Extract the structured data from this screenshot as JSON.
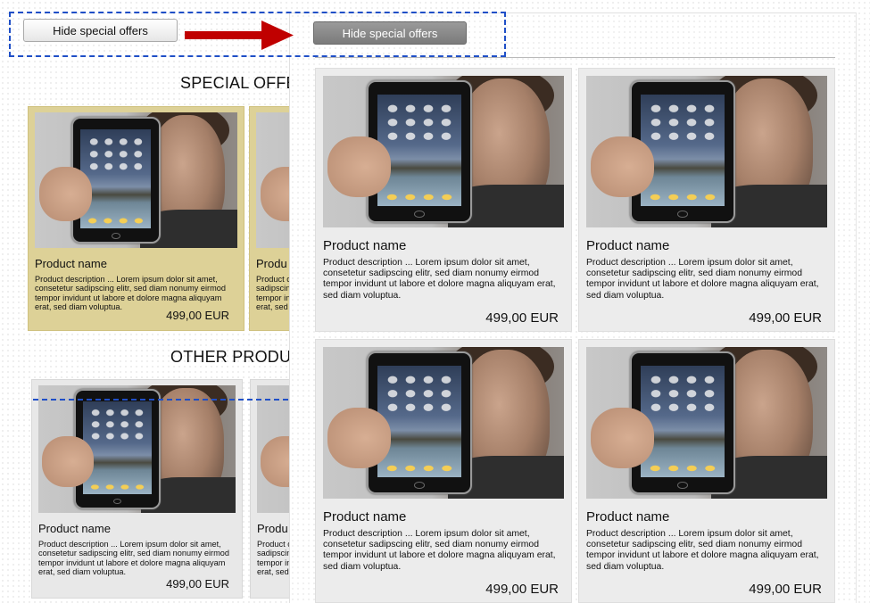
{
  "annotation": {
    "before_button_label": "Hide special offers",
    "after_button_label": "Hide special offers",
    "arrow_color": "#c00000",
    "highlight_color": "#1f4fc7"
  },
  "before_view": {
    "special_heading": "SPECIAL OFFE",
    "other_heading": "OTHER PRODU",
    "special_products": [
      {
        "name": "Product name",
        "description": "Product description  ... Lorem ipsum dolor sit amet, consetetur sadipscing elitr, sed diam nonumy eirmod tempor invidunt ut labore et dolore magna aliquyam erat, sed diam voluptua.",
        "price": "499,00 EUR"
      },
      {
        "name": "Produ",
        "description": "Product c sadipscin tempor in erat, sed",
        "price": ""
      }
    ],
    "other_products": [
      {
        "name": "Product name",
        "description": "Product description  ... Lorem ipsum dolor sit amet, consetetur sadipscing elitr, sed diam nonumy eirmod tempor invidunt ut labore et dolore magna aliquyam erat, sed diam voluptua.",
        "price": "499,00 EUR"
      },
      {
        "name": "Produ",
        "description": "Product c sadipscin tempor in erat, sed",
        "price": ""
      }
    ]
  },
  "after_view": {
    "products": [
      {
        "name": "Product name",
        "description": "Product description  ... Lorem ipsum dolor sit amet, consetetur sadipscing elitr, sed diam nonumy eirmod tempor invidunt ut labore et dolore magna aliquyam erat, sed diam voluptua.",
        "price": "499,00 EUR"
      },
      {
        "name": "Product name",
        "description": "Product description  ... Lorem ipsum dolor sit amet, consetetur sadipscing elitr, sed diam nonumy eirmod tempor invidunt ut labore et dolore magna aliquyam erat, sed diam voluptua.",
        "price": "499,00 EUR"
      },
      {
        "name": "Product name",
        "description": "Product description  ... Lorem ipsum dolor sit amet, consetetur sadipscing elitr, sed diam nonumy eirmod tempor invidunt ut labore et dolore magna aliquyam erat, sed diam voluptua.",
        "price": "499,00 EUR"
      },
      {
        "name": "Product name",
        "description": "Product description  ... Lorem ipsum dolor sit amet, consetetur sadipscing elitr, sed diam nonumy eirmod tempor invidunt ut labore et dolore magna aliquyam erat, sed diam voluptua.",
        "price": "499,00 EUR"
      }
    ]
  },
  "card_colors": {
    "special": "#ddd197",
    "other": "#e8e8e8"
  }
}
